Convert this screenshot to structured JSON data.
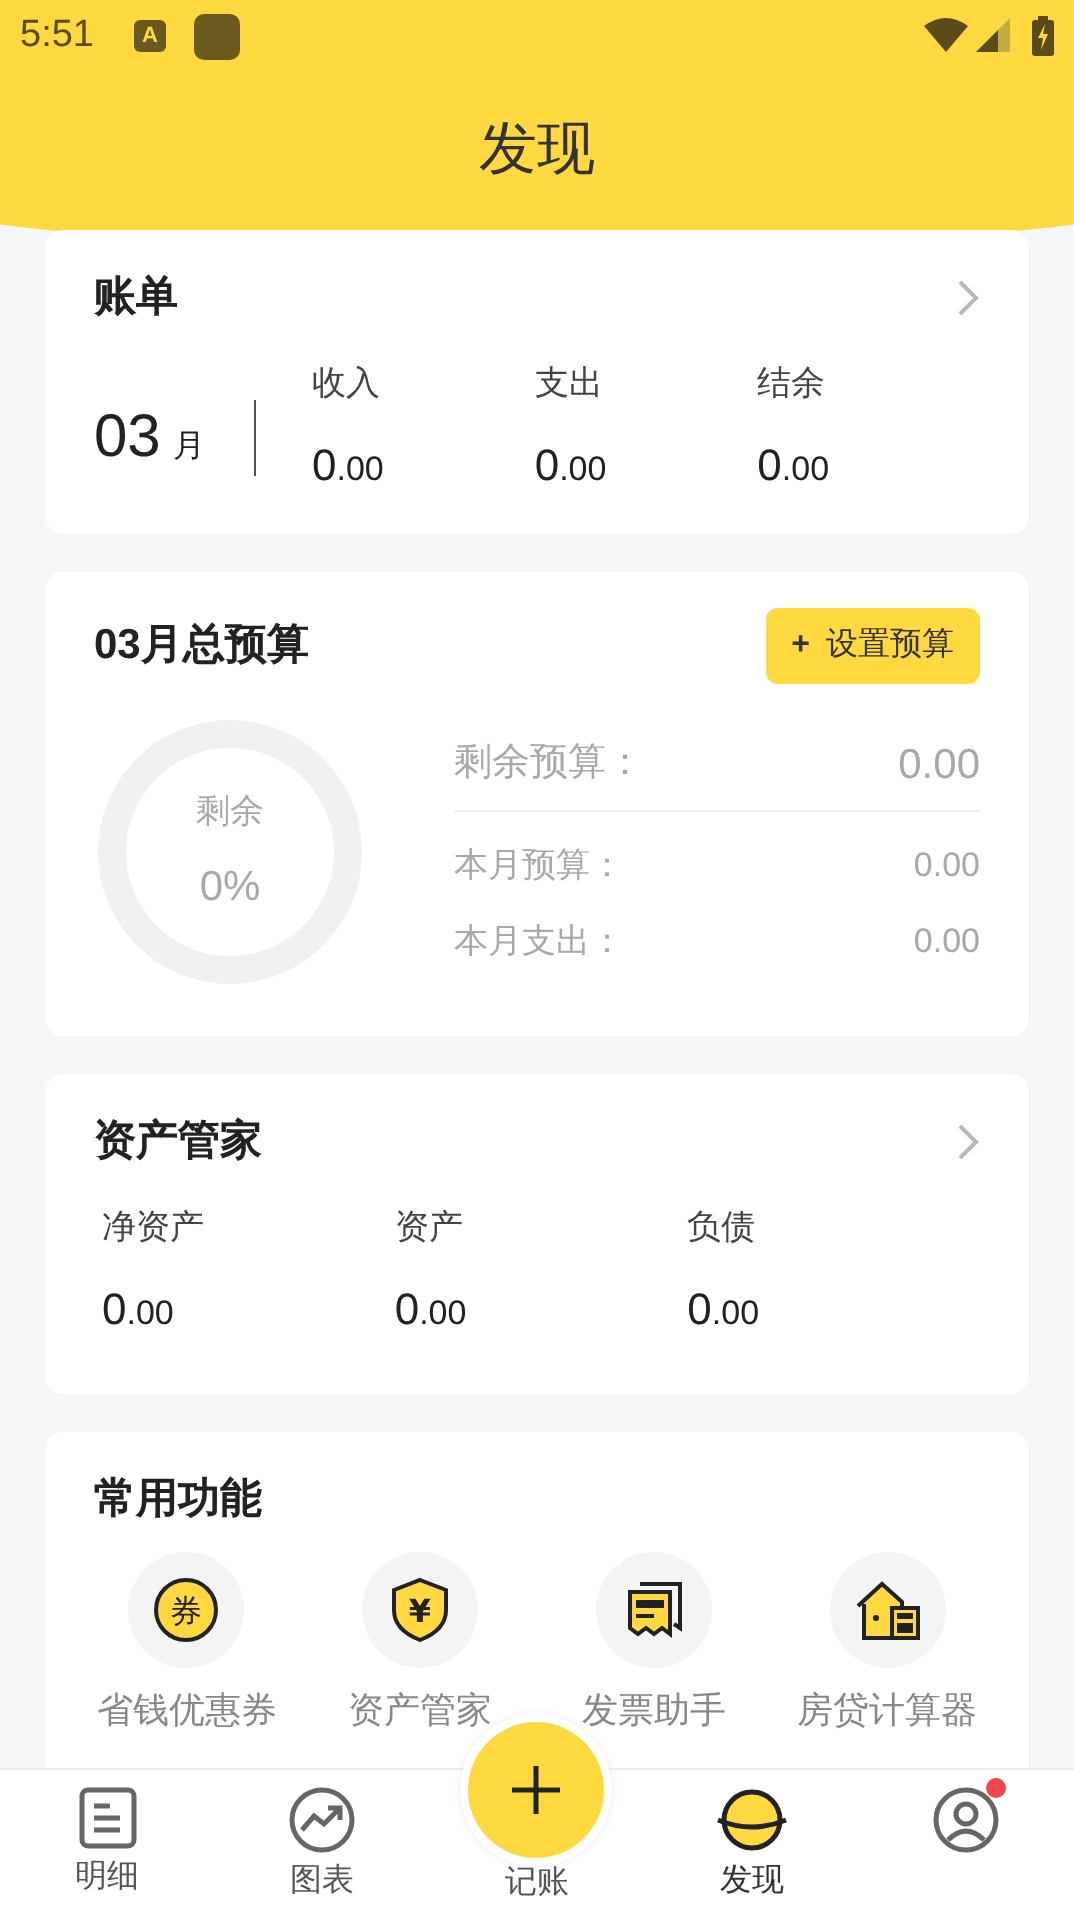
{
  "status_bar": {
    "time": "5:51",
    "keyboard_badge": "A"
  },
  "title": "发现",
  "bill_card": {
    "title": "账单",
    "month": "03",
    "month_unit": "月",
    "stats": [
      {
        "label": "收入",
        "integer": "0",
        "decimal": ".00"
      },
      {
        "label": "支出",
        "integer": "0",
        "decimal": ".00"
      },
      {
        "label": "结余",
        "integer": "0",
        "decimal": ".00"
      }
    ]
  },
  "budget_card": {
    "title": "03月总预算",
    "button_icon": "+",
    "button": "设置预算",
    "ring": {
      "label": "剩余",
      "percent": "0%"
    },
    "remaining": {
      "label": "剩余预算：",
      "value": "0.00"
    },
    "rows": [
      {
        "label": "本月预算：",
        "value": "0.00"
      },
      {
        "label": "本月支出：",
        "value": "0.00"
      }
    ]
  },
  "asset_card": {
    "title": "资产管家",
    "stats": [
      {
        "label": "净资产",
        "integer": "0",
        "decimal": ".00"
      },
      {
        "label": "资产",
        "integer": "0",
        "decimal": ".00"
      },
      {
        "label": "负债",
        "integer": "0",
        "decimal": ".00"
      }
    ]
  },
  "functions_card": {
    "title": "常用功能",
    "items": [
      {
        "label": "省钱优惠券",
        "kind": "coupon",
        "icon_glyph": "券"
      },
      {
        "label": "资产管家",
        "kind": "shield",
        "icon_glyph": "¥"
      },
      {
        "label": "发票助手",
        "kind": "invoice"
      },
      {
        "label": "房贷计算器",
        "kind": "house"
      }
    ]
  },
  "nav": [
    {
      "label": "明细",
      "kind": "list",
      "selected": false
    },
    {
      "label": "图表",
      "kind": "chart",
      "selected": false
    },
    {
      "label": "记账",
      "kind": "add",
      "selected": false
    },
    {
      "label": "发现",
      "kind": "planet",
      "selected": true
    },
    {
      "kind": "profile",
      "selected": false,
      "badge": true
    }
  ]
}
